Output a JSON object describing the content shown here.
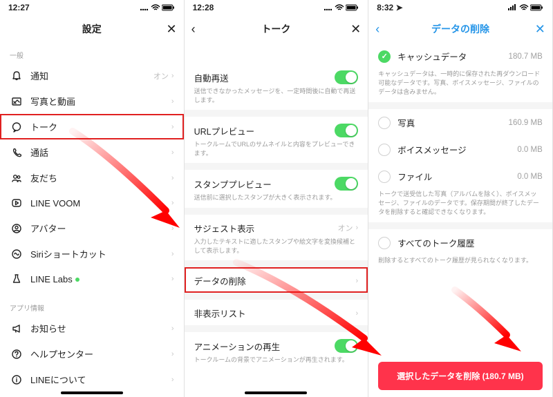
{
  "s1": {
    "time": "12:27",
    "title": "設定",
    "sec_general": "一般",
    "items": [
      {
        "icon": "bell",
        "label": "通知",
        "value": "オン"
      },
      {
        "icon": "image",
        "label": "写真と動画",
        "value": ""
      },
      {
        "icon": "chat",
        "label": "トーク",
        "value": ""
      },
      {
        "icon": "phone",
        "label": "通話",
        "value": ""
      },
      {
        "icon": "people",
        "label": "友だち",
        "value": ""
      },
      {
        "icon": "play",
        "label": "LINE VOOM",
        "value": ""
      },
      {
        "icon": "avatar",
        "label": "アバター",
        "value": ""
      },
      {
        "icon": "siri",
        "label": "Siriショートカット",
        "value": ""
      },
      {
        "icon": "flask",
        "label": "LINE Labs",
        "value": "",
        "dot": true
      }
    ],
    "sec_app": "アプリ情報",
    "items2": [
      {
        "icon": "megaphone",
        "label": "お知らせ"
      },
      {
        "icon": "help",
        "label": "ヘルプセンター"
      },
      {
        "icon": "info",
        "label": "LINEについて"
      }
    ]
  },
  "s2": {
    "time": "12:28",
    "title": "トーク",
    "rows": [
      {
        "title": "自動再送",
        "desc": "送信できなかったメッセージを、一定時間後に自動で再送します。",
        "toggle": true
      },
      {
        "title": "URLプレビュー",
        "desc": "トークルームでURLのサムネイルと内容をプレビューできます。",
        "toggle": true
      },
      {
        "title": "スタンププレビュー",
        "desc": "送信前に選択したスタンプが大きく表示されます。",
        "toggle": true
      },
      {
        "title": "サジェスト表示",
        "desc": "入力したテキストに適したスタンプや絵文字を変換候補として表示します。",
        "value": "オン",
        "chevron": true
      },
      {
        "title": "データの削除",
        "chevron": true,
        "highlight": true
      },
      {
        "title": "非表示リスト",
        "chevron": true
      },
      {
        "title": "アニメーションの再生",
        "desc": "トークルームの背景でアニメーションが再生されます。",
        "toggle": true
      }
    ]
  },
  "s3": {
    "time": "8:32",
    "title": "データの削除",
    "cache": {
      "label": "キャッシュデータ",
      "size": "180.7 MB",
      "checked": true
    },
    "cache_desc": "キャッシュデータは、一時的に保存された再ダウンロード可能なデータです。写真、ボイスメッセージ、ファイルのデータは含みません。",
    "items": [
      {
        "label": "写真",
        "size": "160.9 MB"
      },
      {
        "label": "ボイスメッセージ",
        "size": "0.0 MB"
      },
      {
        "label": "ファイル",
        "size": "0.0 MB"
      }
    ],
    "items_desc": "トークで送受信した写真（アルバムを除く）、ボイスメッセージ、ファイルのデータです。保存期間が終了したデータを削除すると確認できなくなります。",
    "all": {
      "label": "すべてのトーク履歴"
    },
    "all_desc": "削除するとすべてのトーク履歴が見られなくなります。",
    "delete_btn": "選択したデータを削除 (180.7 MB)"
  }
}
